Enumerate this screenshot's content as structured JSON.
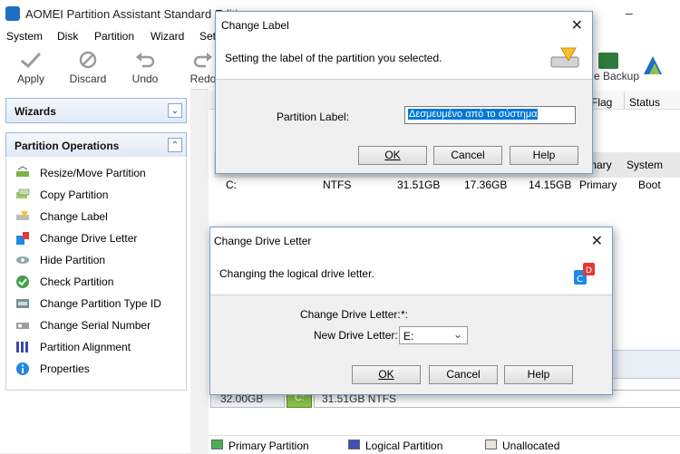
{
  "app": {
    "title": "AOMEI Partition Assistant Standard Editi",
    "minimize_glyph": "–"
  },
  "menu": [
    "System",
    "Disk",
    "Partition",
    "Wizard",
    "Set"
  ],
  "toolbar": {
    "apply": "Apply",
    "discard": "Discard",
    "undo": "Undo",
    "redo": "Redo",
    "backup": "e Backup"
  },
  "left": {
    "wizards_title": "Wizards",
    "ops_title": "Partition Operations",
    "ops": [
      {
        "label": "Resize/Move Partition",
        "icon": "resize-icon"
      },
      {
        "label": "Copy Partition",
        "icon": "copy-icon"
      },
      {
        "label": "Change Label",
        "icon": "label-icon"
      },
      {
        "label": "Change Drive Letter",
        "icon": "drive-letter-icon"
      },
      {
        "label": "Hide Partition",
        "icon": "hide-icon"
      },
      {
        "label": "Check Partition",
        "icon": "check-icon"
      },
      {
        "label": "Change Partition Type ID",
        "icon": "type-id-icon"
      },
      {
        "label": "Change Serial Number",
        "icon": "serial-icon"
      },
      {
        "label": "Partition Alignment",
        "icon": "alignment-icon"
      },
      {
        "label": "Properties",
        "icon": "properties-icon"
      }
    ]
  },
  "table": {
    "headers": {
      "flag": "Flag",
      "status": "Status",
      "primary": "mary",
      "system": "System"
    },
    "row_c": {
      "label": "C:",
      "fs": "NTFS",
      "capacity": "31.51GB",
      "used": "17.36GB",
      "free": "14.15GB",
      "type": "Primary",
      "status": "Boot"
    }
  },
  "disk_map": {
    "size": "32.00GB",
    "part_letter": "C:",
    "part_info": "31.51GB NTFS"
  },
  "legend": {
    "primary": "Primary Partition",
    "logical": "Logical Partition",
    "unallocated": "Unallocated"
  },
  "colors": {
    "primary": "#4caf50",
    "logical": "#3f51b5",
    "unallocated": "#e8e4d8",
    "selection": "#0078d7"
  },
  "change_label": {
    "title": "Change Label",
    "description": "Setting the label of the partition you selected.",
    "field_label": "Partition Label:",
    "field_value": "Δεσμευμένο από το σύστημα",
    "ok": "OK",
    "cancel": "Cancel",
    "help": "Help"
  },
  "change_letter": {
    "title": "Change Drive Letter",
    "description": "Changing the logical drive letter.",
    "current_label": "Change Drive Letter:",
    "current_value": "*:",
    "new_label": "New Drive Letter:",
    "new_value": "E:",
    "ok": "OK",
    "cancel": "Cancel",
    "help": "Help"
  }
}
